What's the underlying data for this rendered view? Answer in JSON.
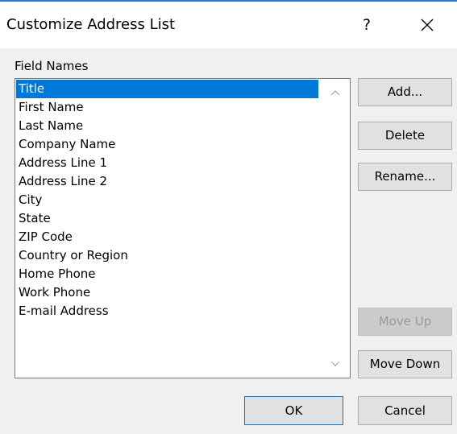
{
  "dialog": {
    "title": "Customize Address List",
    "help_label": "?",
    "close_label": "✕",
    "accent_color": "#1f7ad1",
    "selection_color": "#0078d7"
  },
  "field_names": {
    "label": "Field Names",
    "selected_index": 0,
    "items": [
      "Title",
      "First Name",
      "Last Name",
      "Company Name",
      "Address Line 1",
      "Address Line 2",
      "City",
      "State",
      "ZIP Code",
      "Country or Region",
      "Home Phone",
      "Work Phone",
      "E-mail Address"
    ],
    "scroll_up_icon": "chevron-up",
    "scroll_down_icon": "chevron-down"
  },
  "buttons": {
    "add": "Add...",
    "delete": "Delete",
    "rename": "Rename...",
    "move_up": "Move Up",
    "move_up_enabled": false,
    "move_down": "Move Down",
    "ok": "OK",
    "cancel": "Cancel"
  }
}
